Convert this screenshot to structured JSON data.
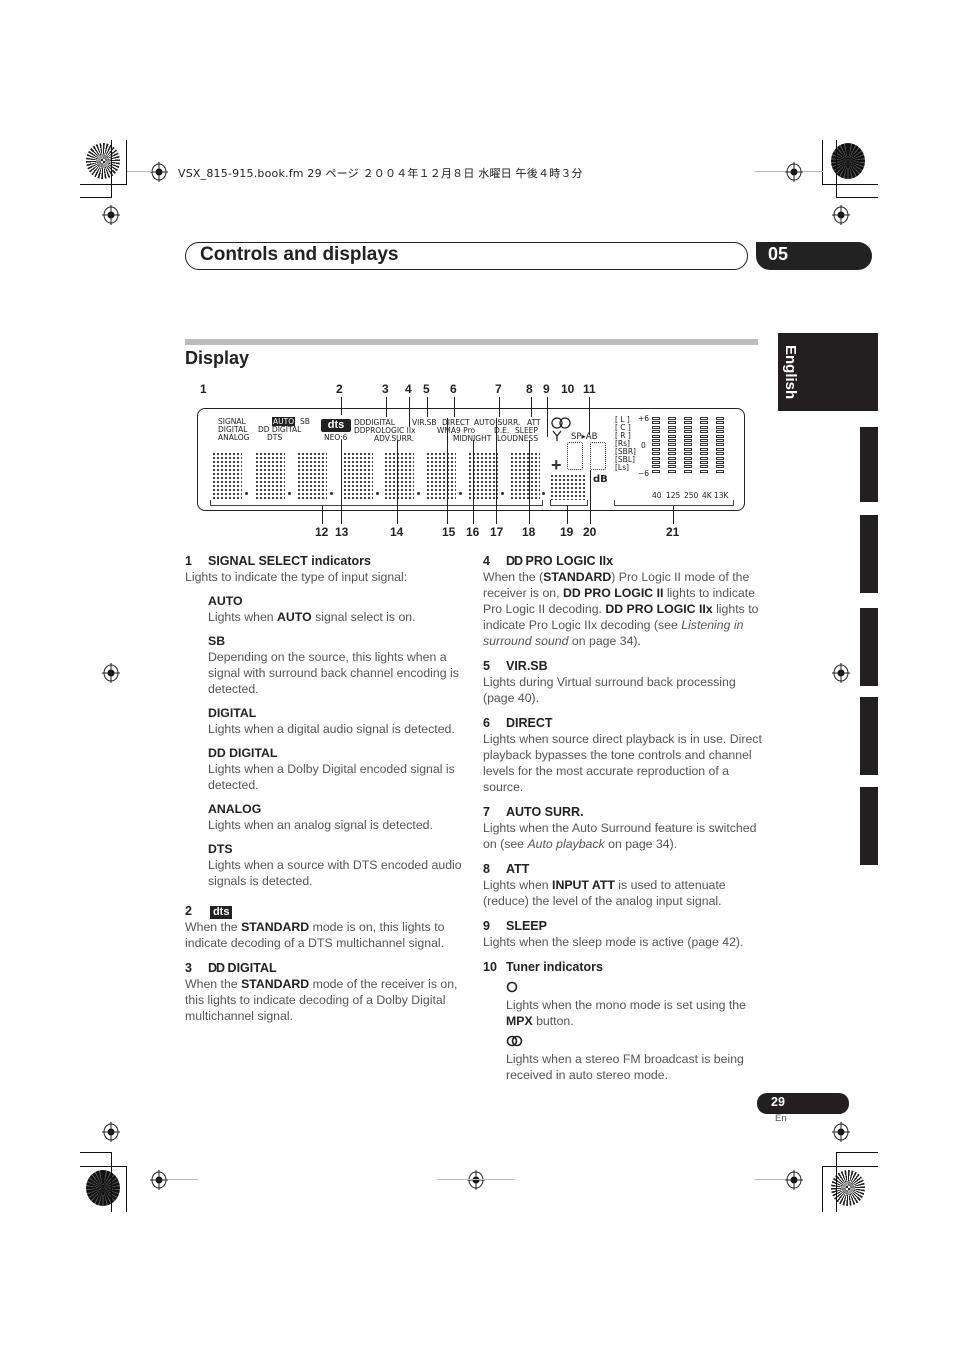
{
  "file_header": "VSX_815-915.book.fm  29 ページ  ２００４年１２月８日  水曜日  午後４時３分",
  "chapter": {
    "title": "Controls and displays",
    "number": "05"
  },
  "language_tab": "English",
  "section": {
    "title": "Display"
  },
  "diagram": {
    "callouts_top": [
      "1",
      "2",
      "3",
      "4",
      "5",
      "6",
      "7",
      "8",
      "9",
      "10",
      "11"
    ],
    "callouts_bottom": [
      "12",
      "13",
      "14",
      "15",
      "16",
      "17",
      "18",
      "19",
      "20",
      "21"
    ],
    "indicators": {
      "signal": "SIGNAL",
      "auto": "AUTO",
      "sb": "SB",
      "digital": "DIGITAL",
      "dd_digital": "DD DIGITAL",
      "analog": "ANALOG",
      "dts_small": "DTS",
      "dts_logo": "dts",
      "neo6": "NEO:6",
      "dd_digital_2": "DDDIGITAL",
      "prologic": "DDPROLOGIC IIx",
      "adv_surr": "ADV.SURR.",
      "vir_sb": "VIR.SB",
      "direct": "DIRECT",
      "wma9": "WMA9 Pro",
      "midnight": "MIDNIGHT",
      "auto_surr": "AUTO SURR.",
      "att": "ATT",
      "de": "D.E.",
      "sleep": "SLEEP",
      "loudness": "LOUDNESS",
      "sp_ab": "SP▸AB",
      "db": "dB",
      "channels": [
        "[ L ]",
        "[ C ]",
        "[ R ]",
        "[Rs]",
        "[SBR]",
        "[SBL]",
        "[Ls]"
      ],
      "eq_scale": [
        "+6",
        "0",
        "−6"
      ],
      "eq_freqs": [
        "40",
        "125",
        "250",
        "4K",
        "13K"
      ]
    }
  },
  "left_column": {
    "items": [
      {
        "num": "1",
        "title": "SIGNAL SELECT indicators",
        "text": "Lights to indicate the type of input signal:",
        "subitems": [
          {
            "title": "AUTO",
            "text_pre": "Lights when ",
            "bold": "AUTO",
            "text_post": " signal select is on."
          },
          {
            "title": "SB",
            "text": "Depending on the source, this lights when a signal with surround back channel encoding is detected."
          },
          {
            "title": "DIGITAL",
            "text": "Lights when a digital audio signal is detected."
          },
          {
            "title": "DD DIGITAL",
            "text": "Lights when a Dolby Digital encoded signal is detected."
          },
          {
            "title": "ANALOG",
            "text": "Lights when an analog signal is detected."
          },
          {
            "title": "DTS",
            "text": "Lights when a source with DTS encoded audio signals is detected."
          }
        ]
      },
      {
        "num": "2",
        "badge": "dts",
        "text_pre": "When the ",
        "bold": "STANDARD",
        "text_post": " mode is on, this lights to indicate decoding of a DTS multichannel signal."
      },
      {
        "num": "3",
        "title_logo": "DD",
        "title": "DIGITAL",
        "text_pre": "When the ",
        "bold": "STANDARD",
        "text_post": " mode of the receiver is on, this lights to indicate decoding of a Dolby Digital multichannel signal."
      }
    ]
  },
  "right_column": {
    "items": [
      {
        "num": "4",
        "title_logo": "DD",
        "title": "PRO LOGIC IIx",
        "p1": "When the (",
        "b1": "STANDARD",
        "p2": ") Pro Logic II mode of the receiver is on, ",
        "b2": "DD PRO LOGIC II",
        "p3": " lights to indicate Pro Logic II decoding. ",
        "b3": "DD PRO LOGIC IIx",
        "p4": " lights to indicate Pro Logic IIx decoding (see ",
        "i1": "Listening in surround sound",
        "p5": " on page 34)."
      },
      {
        "num": "5",
        "title": "VIR.SB",
        "text": "Lights during Virtual surround back processing (page 40)."
      },
      {
        "num": "6",
        "title": "DIRECT",
        "text": "Lights when source direct playback is in use. Direct playback bypasses the tone controls and channel levels for the most accurate reproduction of a source."
      },
      {
        "num": "7",
        "title": "AUTO SURR.",
        "p1": "Lights when the Auto Surround feature is switched on (see ",
        "i1": "Auto playback",
        "p2": " on page 34)."
      },
      {
        "num": "8",
        "title": "ATT",
        "p1": "Lights when ",
        "b1": "INPUT ATT",
        "p2": " is used to attenuate (reduce) the level of the analog input signal."
      },
      {
        "num": "9",
        "title": "SLEEP",
        "text": "Lights when the sleep mode is active (page 42)."
      },
      {
        "num": "10",
        "title": "Tuner indicators",
        "subitems": [
          {
            "icon": "mono-icon",
            "p1": "Lights when the mono mode is set using the ",
            "b1": "MPX",
            "p2": " button."
          },
          {
            "icon": "stereo-icon",
            "text": "Lights when a stereo FM broadcast is being received in auto stereo mode."
          }
        ]
      }
    ]
  },
  "footer": {
    "page_number": "29",
    "page_lang": "En"
  }
}
